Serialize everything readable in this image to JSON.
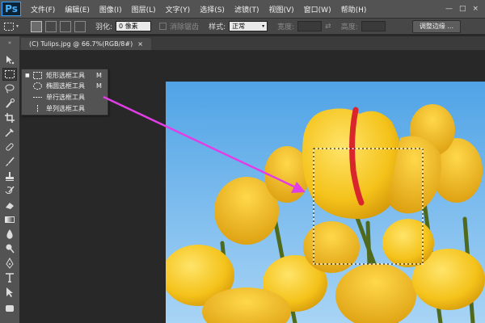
{
  "app": {
    "logo": "Ps"
  },
  "menu": {
    "items": [
      "文件(F)",
      "编辑(E)",
      "图像(I)",
      "图层(L)",
      "文字(Y)",
      "选择(S)",
      "滤镜(T)",
      "视图(V)",
      "窗口(W)",
      "帮助(H)"
    ]
  },
  "window_controls": [
    "—",
    "□",
    "×"
  ],
  "options": {
    "feather_label": "羽化:",
    "feather_value": "0 像素",
    "antialias_label": "消除锯齿",
    "style_label": "样式:",
    "style_value": "正常",
    "width_label": "宽度:",
    "height_label": "高度:",
    "refine_edge_button": "调整边缘 ..."
  },
  "document": {
    "tab_title": "(C) Tulips.jpg @ 66.7%(RGB/8#)",
    "close_glyph": "×"
  },
  "flyout": {
    "items": [
      {
        "label": "矩形选框工具",
        "shortcut": "M",
        "selected": true,
        "icon": "rect-marquee-icon"
      },
      {
        "label": "椭圆选框工具",
        "shortcut": "M",
        "selected": false,
        "icon": "ellipse-marquee-icon"
      },
      {
        "label": "单行选框工具",
        "shortcut": "",
        "selected": false,
        "icon": "single-row-marquee-icon"
      },
      {
        "label": "单列选框工具",
        "shortcut": "",
        "selected": false,
        "icon": "single-column-marquee-icon"
      }
    ],
    "bullet": "■"
  },
  "tools": [
    "move-tool-icon",
    "rect-marquee-tool-icon",
    "lasso-tool-icon",
    "quick-select-tool-icon",
    "crop-tool-icon",
    "eyedropper-tool-icon",
    "healing-brush-tool-icon",
    "brush-tool-icon",
    "clone-stamp-tool-icon",
    "history-brush-tool-icon",
    "eraser-tool-icon",
    "gradient-tool-icon",
    "blur-tool-icon",
    "dodge-tool-icon",
    "pen-tool-icon",
    "type-tool-icon",
    "path-select-tool-icon",
    "shape-tool-icon"
  ],
  "colors": {
    "annotation_arrow": "#e23ee6",
    "sky": "#6fb6ec",
    "tulip": "#f4c21a",
    "red_tulip_stripe": "#d9262c"
  }
}
